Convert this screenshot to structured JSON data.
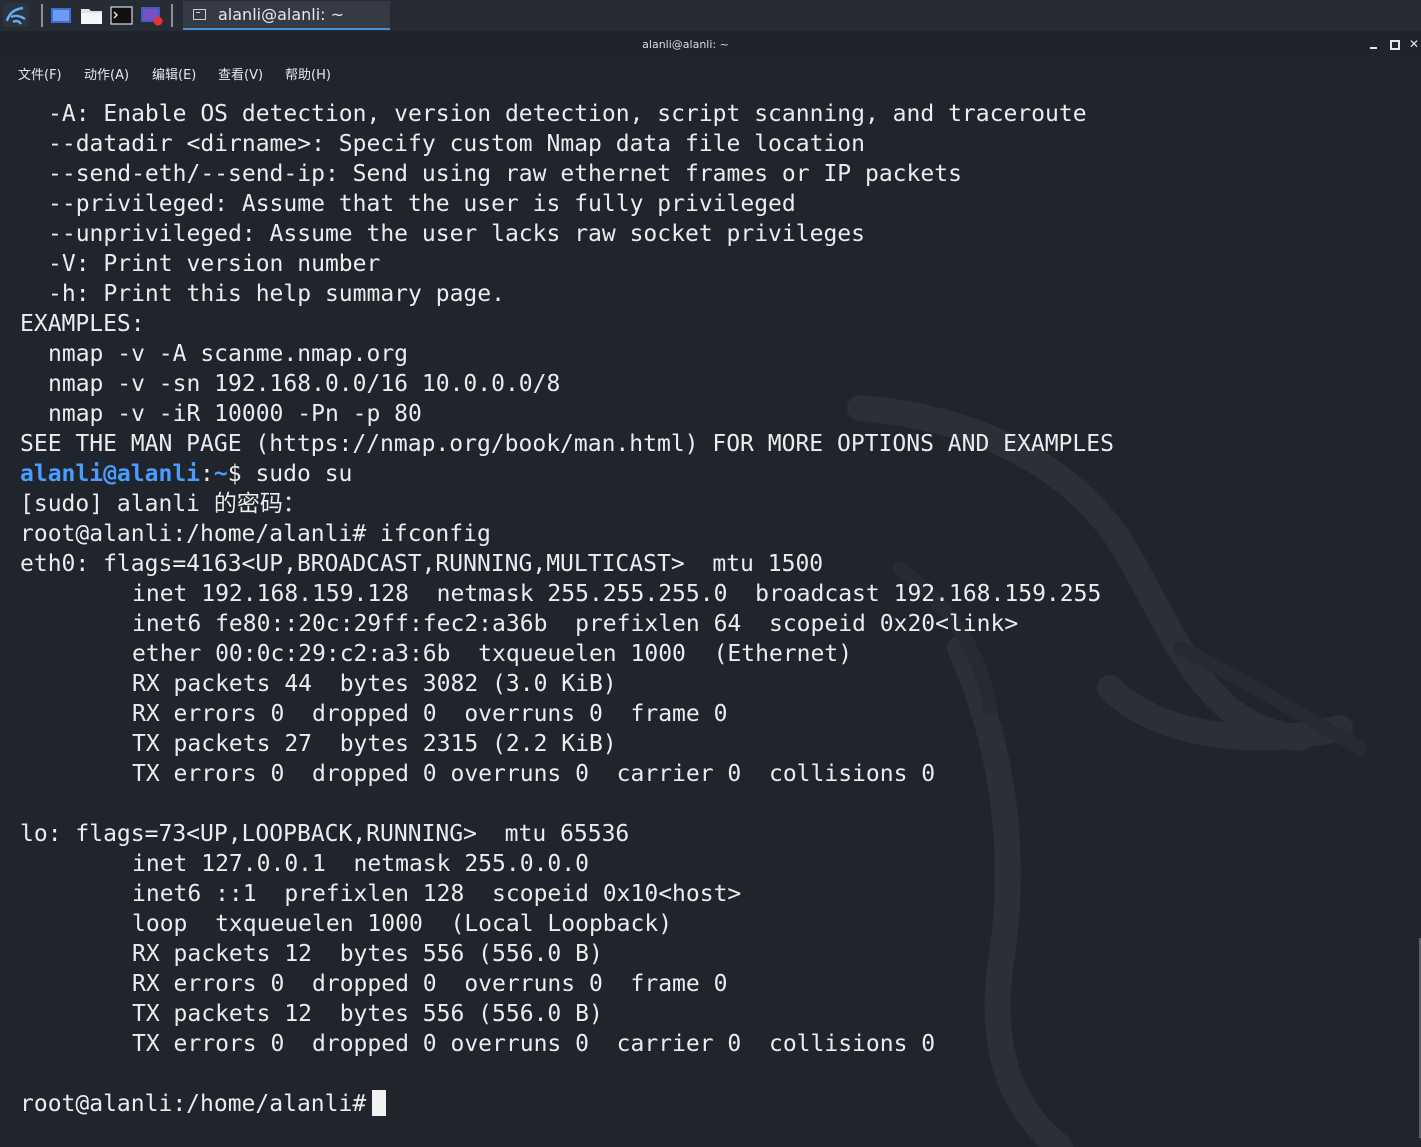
{
  "taskbar": {
    "task_label": "alanli@alanli: ~",
    "icons": [
      "kali-menu-icon",
      "workspace-icon",
      "folder-icon",
      "terminal-icon",
      "screen-record-icon"
    ]
  },
  "window": {
    "title": "alanli@alanli: ~",
    "menu": [
      "文件(F)",
      "动作(A)",
      "编辑(E)",
      "查看(V)",
      "帮助(H)"
    ]
  },
  "terminal": {
    "lines": [
      "-A: Enable OS detection, version detection, script scanning, and traceroute",
      "--datadir <dirname>: Specify custom Nmap data file location",
      "--send-eth/--send-ip: Send using raw ethernet frames or IP packets",
      "--privileged: Assume that the user is fully privileged",
      "--unprivileged: Assume the user lacks raw socket privileges",
      "-V: Print version number",
      "-h: Print this help summary page.",
      "EXAMPLES:",
      "nmap -v -A scanme.nmap.org",
      "nmap -v -sn 192.168.0.0/16 10.0.0.0/8",
      "nmap -v -iR 10000 -Pn -p 80",
      "SEE THE MAN PAGE (https://nmap.org/book/man.html) FOR MORE OPTIONS AND EXAMPLES",
      "",
      "[sudo] alanli 的密码：",
      "root@alanli:/home/alanli# ifconfig",
      "eth0: flags=4163<UP,BROADCAST,RUNNING,MULTICAST>  mtu 1500",
      "inet 192.168.159.128  netmask 255.255.255.0  broadcast 192.168.159.255",
      "inet6 fe80::20c:29ff:fec2:a36b  prefixlen 64  scopeid 0x20<link>",
      "ether 00:0c:29:c2:a3:6b  txqueuelen 1000  (Ethernet)",
      "RX packets 44  bytes 3082 (3.0 KiB)",
      "RX errors 0  dropped 0  overruns 0  frame 0",
      "TX packets 27  bytes 2315 (2.2 KiB)",
      "TX errors 0  dropped 0 overruns 0  carrier 0  collisions 0",
      "lo: flags=73<UP,LOOPBACK,RUNNING>  mtu 65536",
      "inet 127.0.0.1  netmask 255.0.0.0",
      "inet6 ::1  prefixlen 128  scopeid 0x10<host>",
      "loop  txqueuelen 1000  (Local Loopback)",
      "RX packets 12  bytes 556 (556.0 B)",
      "RX errors 0  dropped 0  overruns 0  frame 0",
      "TX packets 12  bytes 556 (556.0 B)",
      "TX errors 0  dropped 0 overruns 0  carrier 0  collisions 0"
    ],
    "prompt": {
      "user": "alanli@alanli",
      "sep": ":",
      "path": "~",
      "symbol": "$",
      "command": "sudo su"
    },
    "final_prompt": "root@alanli:/home/alanli#"
  },
  "colors": {
    "background": "#20242c",
    "prompt_user": "#4a9dfc",
    "text": "#ececec"
  }
}
